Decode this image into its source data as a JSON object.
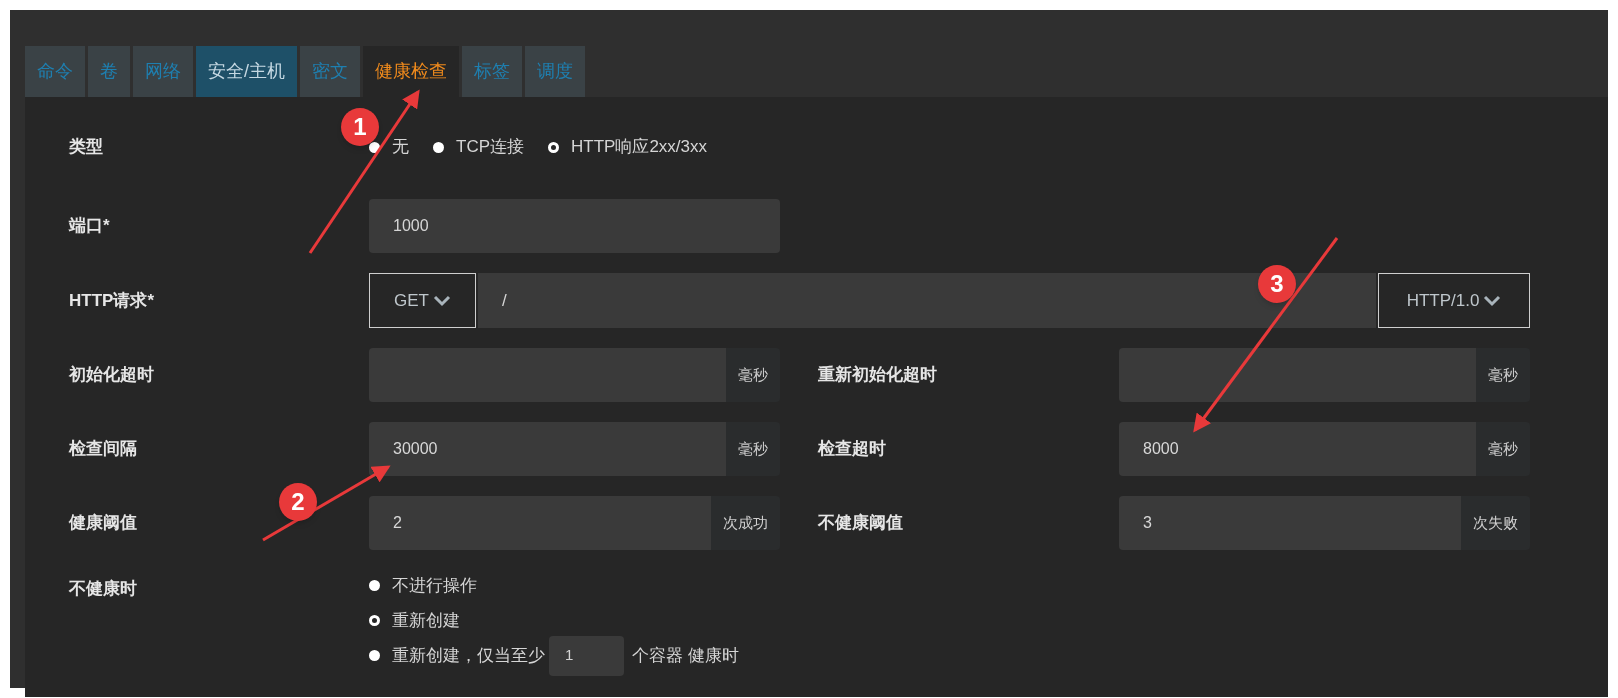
{
  "tabs": [
    {
      "label": "命令",
      "selected": false
    },
    {
      "label": "卷",
      "selected": false
    },
    {
      "label": "网络",
      "selected": false
    },
    {
      "label": "安全/主机",
      "selected": false
    },
    {
      "label": "密文",
      "selected": false
    },
    {
      "label": "健康检查",
      "selected": true
    },
    {
      "label": "标签",
      "selected": false
    },
    {
      "label": "调度",
      "selected": false
    }
  ],
  "type": {
    "label": "类型",
    "options": [
      {
        "label": "无",
        "selected": false
      },
      {
        "label": "TCP连接",
        "selected": false
      },
      {
        "label": "HTTP响应2xx/3xx",
        "selected": true
      }
    ]
  },
  "port": {
    "label": "端口*",
    "value": "1000"
  },
  "http_request": {
    "label": "HTTP请求*",
    "method": "GET",
    "path": "/",
    "version": "HTTP/1.0"
  },
  "timeouts": [
    {
      "label": "初始化超时",
      "unit": "毫秒"
    },
    {
      "label": "重新初始化超时",
      "unit": "毫秒"
    },
    {
      "label": "检查间隔",
      "value": "30000",
      "unit": "毫秒"
    },
    {
      "label": "检查超时",
      "value": "8000",
      "unit": "毫秒"
    },
    {
      "label": "健康阈值",
      "value": "2",
      "unit": "次成功"
    },
    {
      "label": "不健康阈值",
      "value": "3",
      "unit": "次失败"
    }
  ],
  "unhealthy": {
    "label": "不健康时",
    "options": [
      {
        "label": "不进行操作",
        "selected": false
      },
      {
        "label": "重新创建",
        "selected": true
      },
      {
        "label": "重新创建，仅当至少",
        "selected": false,
        "value": "1",
        "suffix": "个容器 健康时"
      }
    ]
  },
  "annotations": [
    {
      "label": "1"
    },
    {
      "label": "2"
    },
    {
      "label": "3"
    }
  ]
}
